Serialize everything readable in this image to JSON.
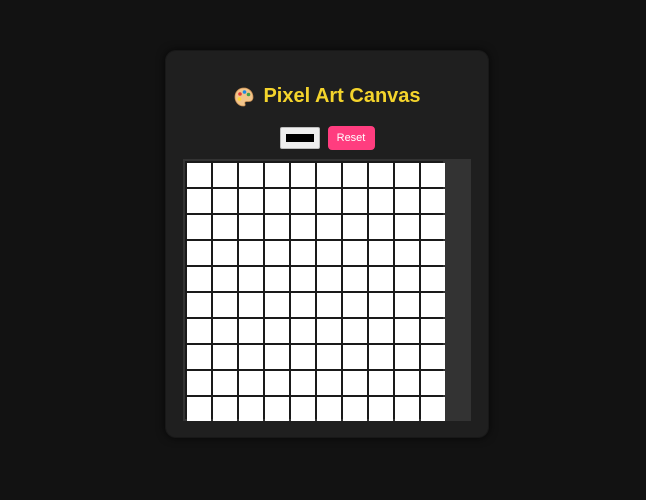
{
  "app": {
    "title": "Pixel Art Canvas",
    "icon": "palette-icon"
  },
  "controls": {
    "color_value": "#000000",
    "reset_label": "Reset"
  },
  "canvas": {
    "rows": 10,
    "cols": 10,
    "pixel_color": "#ffffff"
  },
  "colors": {
    "title": "#f4d42c",
    "accent": "#ff3d7f",
    "background": "#121212",
    "card": "#1f1f1f"
  }
}
